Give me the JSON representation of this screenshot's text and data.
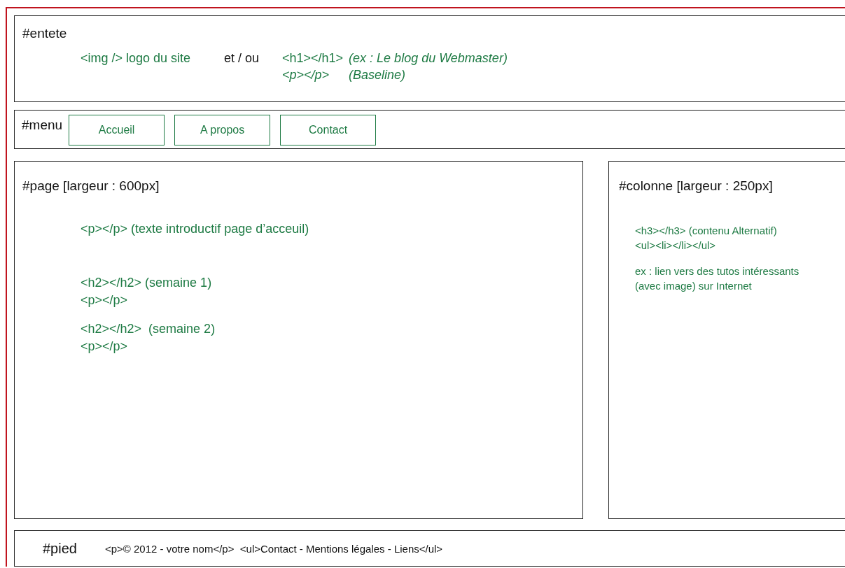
{
  "header": {
    "label": "#entete",
    "logo": "<img /> logo du site",
    "separator": "et / ou",
    "title_tag": "<h1></h1>",
    "title_note": "(ex : Le blog du Webmaster)",
    "baseline_tag": "<p></p>",
    "baseline_note": "(Baseline)"
  },
  "menu": {
    "label": "#menu",
    "items": [
      "Accueil",
      "A propos",
      "Contact"
    ]
  },
  "page": {
    "label": "#page [largeur : 600px]",
    "blocks": [
      {
        "lines": [
          "<p></p> (texte introductif page d’acceuil)"
        ]
      },
      {
        "lines": [
          "<h2></h2> (semaine 1)",
          "<p></p>"
        ]
      },
      {
        "lines": [
          "<h2></h2>  (semaine 2)",
          "<p></p>"
        ]
      }
    ]
  },
  "column": {
    "label": "#colonne [largeur : 250px]",
    "blocks": [
      {
        "lines": [
          "<h3></h3> (contenu Alternatif)",
          "<ul><li></li></ul>"
        ]
      },
      {
        "lines": [
          "ex : lien vers des tutos intéressants",
          "(avec image) sur Internet"
        ]
      }
    ]
  },
  "footer": {
    "label": "#pied",
    "text": "<p>© 2012 - votre nom</p>  <ul>Contact - Mentions légales - Liens</ul>"
  }
}
